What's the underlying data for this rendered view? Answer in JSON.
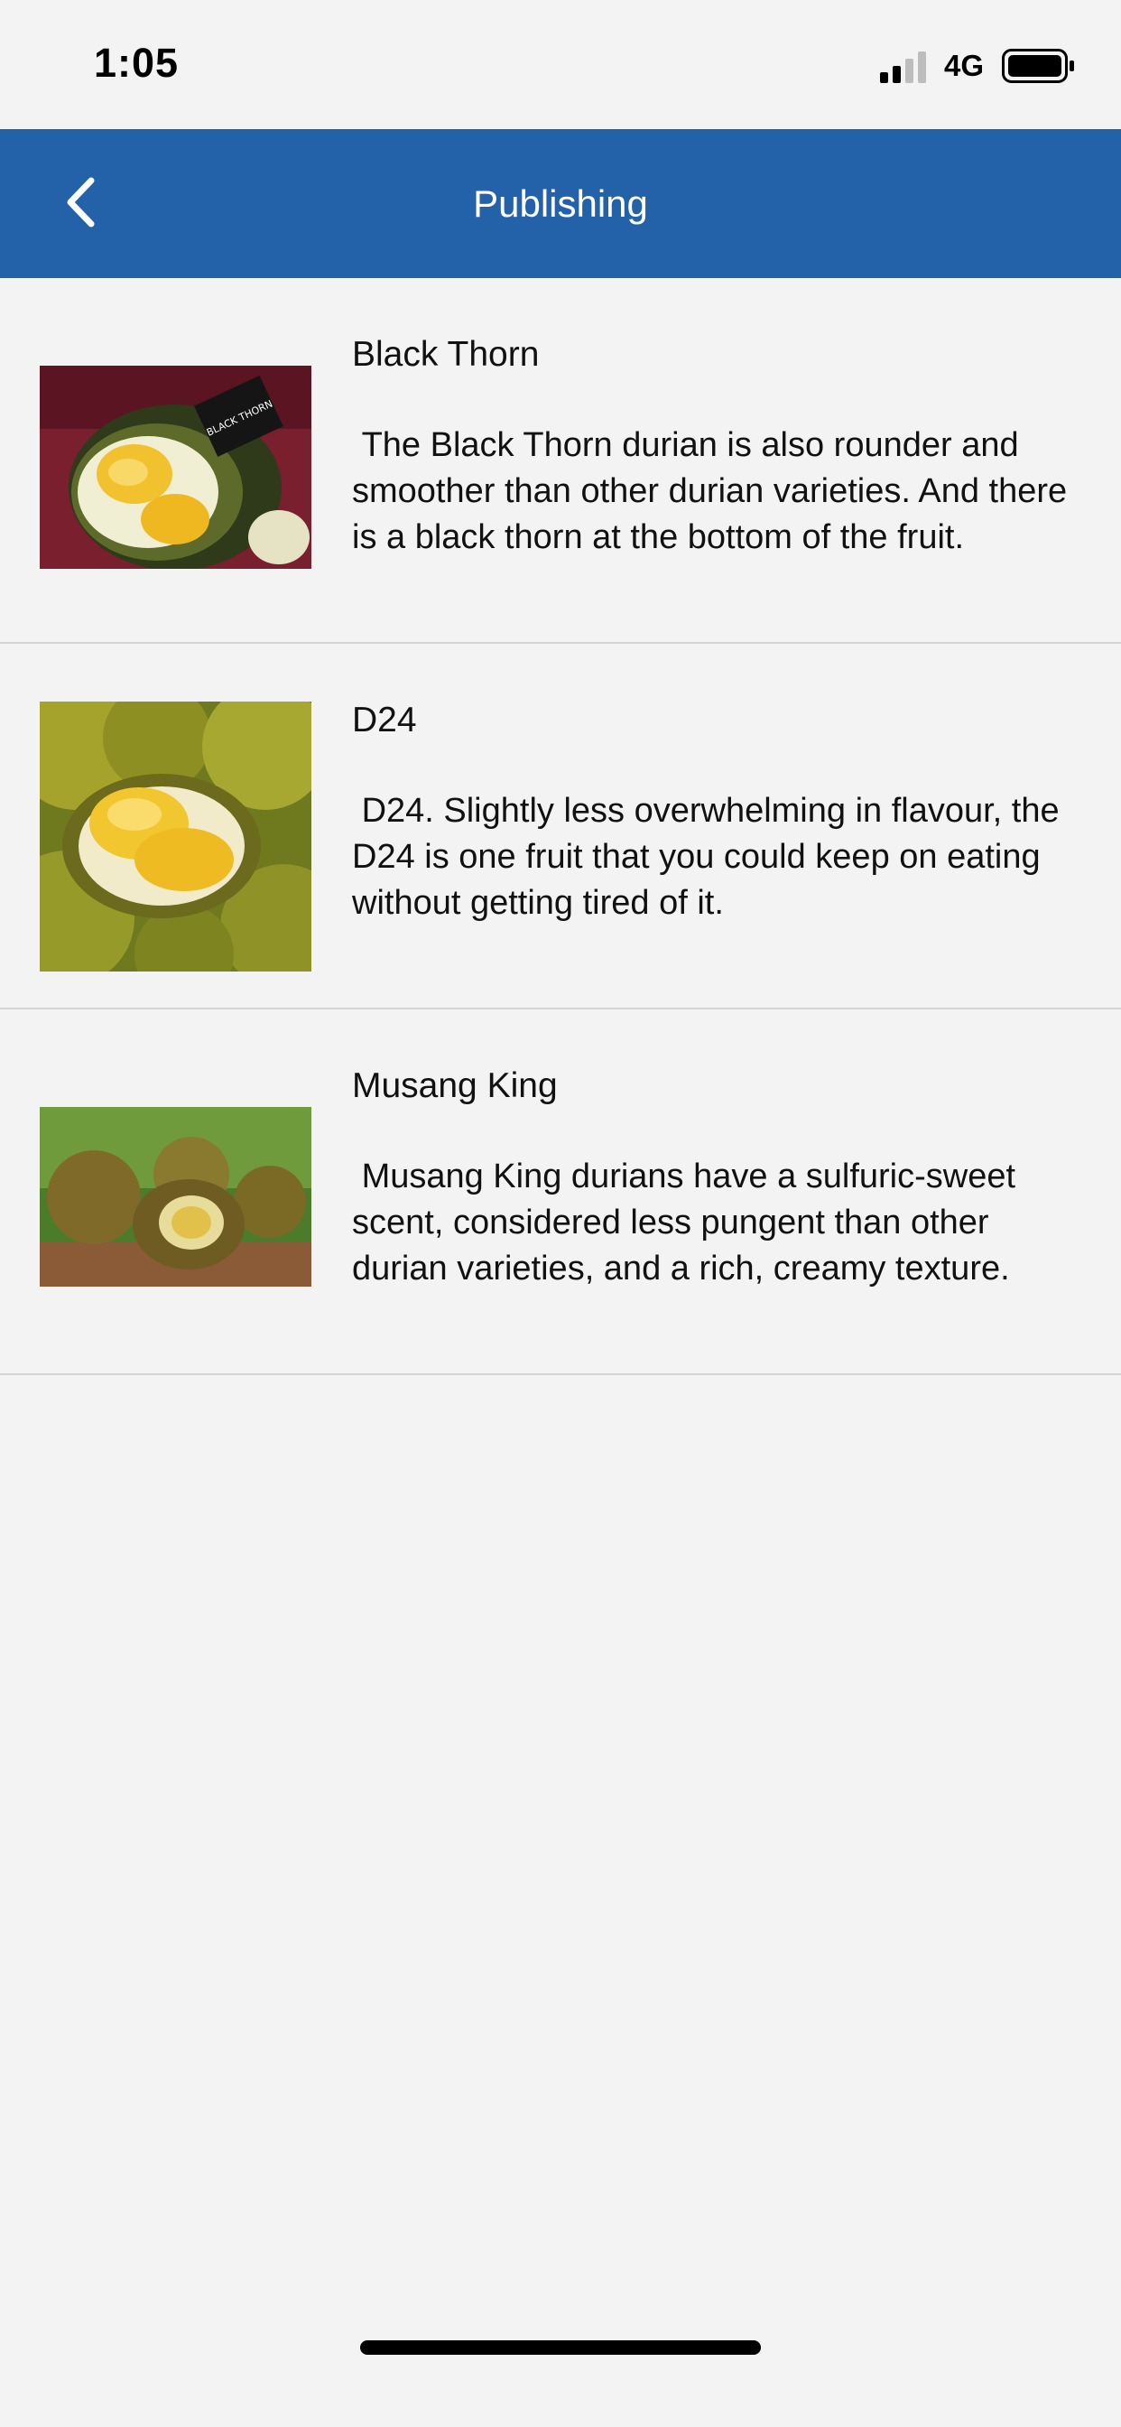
{
  "status_bar": {
    "time": "1:05",
    "network": "4G",
    "icons": [
      "signal-icon",
      "battery-icon"
    ]
  },
  "nav": {
    "title": "Publishing",
    "back_icon": "chevron-left-icon"
  },
  "items": [
    {
      "title": "Black Thorn",
      "description": " The Black Thorn durian is also rounder and smoother than other durian varieties. And there is a black thorn at the bottom of the fruit.",
      "image_label": "BLACK THORN"
    },
    {
      "title": "D24",
      "description": " D24. Slightly less overwhelming in flavour, the D24 is one fruit that you could keep on eating without getting tired of it."
    },
    {
      "title": "Musang King",
      "description": " Musang King durians have a sulfuric-sweet scent, considered less pungent than other durian varieties, and a rich, creamy texture."
    }
  ],
  "colors": {
    "nav_background": "#2362a8",
    "page_background": "#f3f3f3",
    "divider": "#d4d4d4"
  }
}
